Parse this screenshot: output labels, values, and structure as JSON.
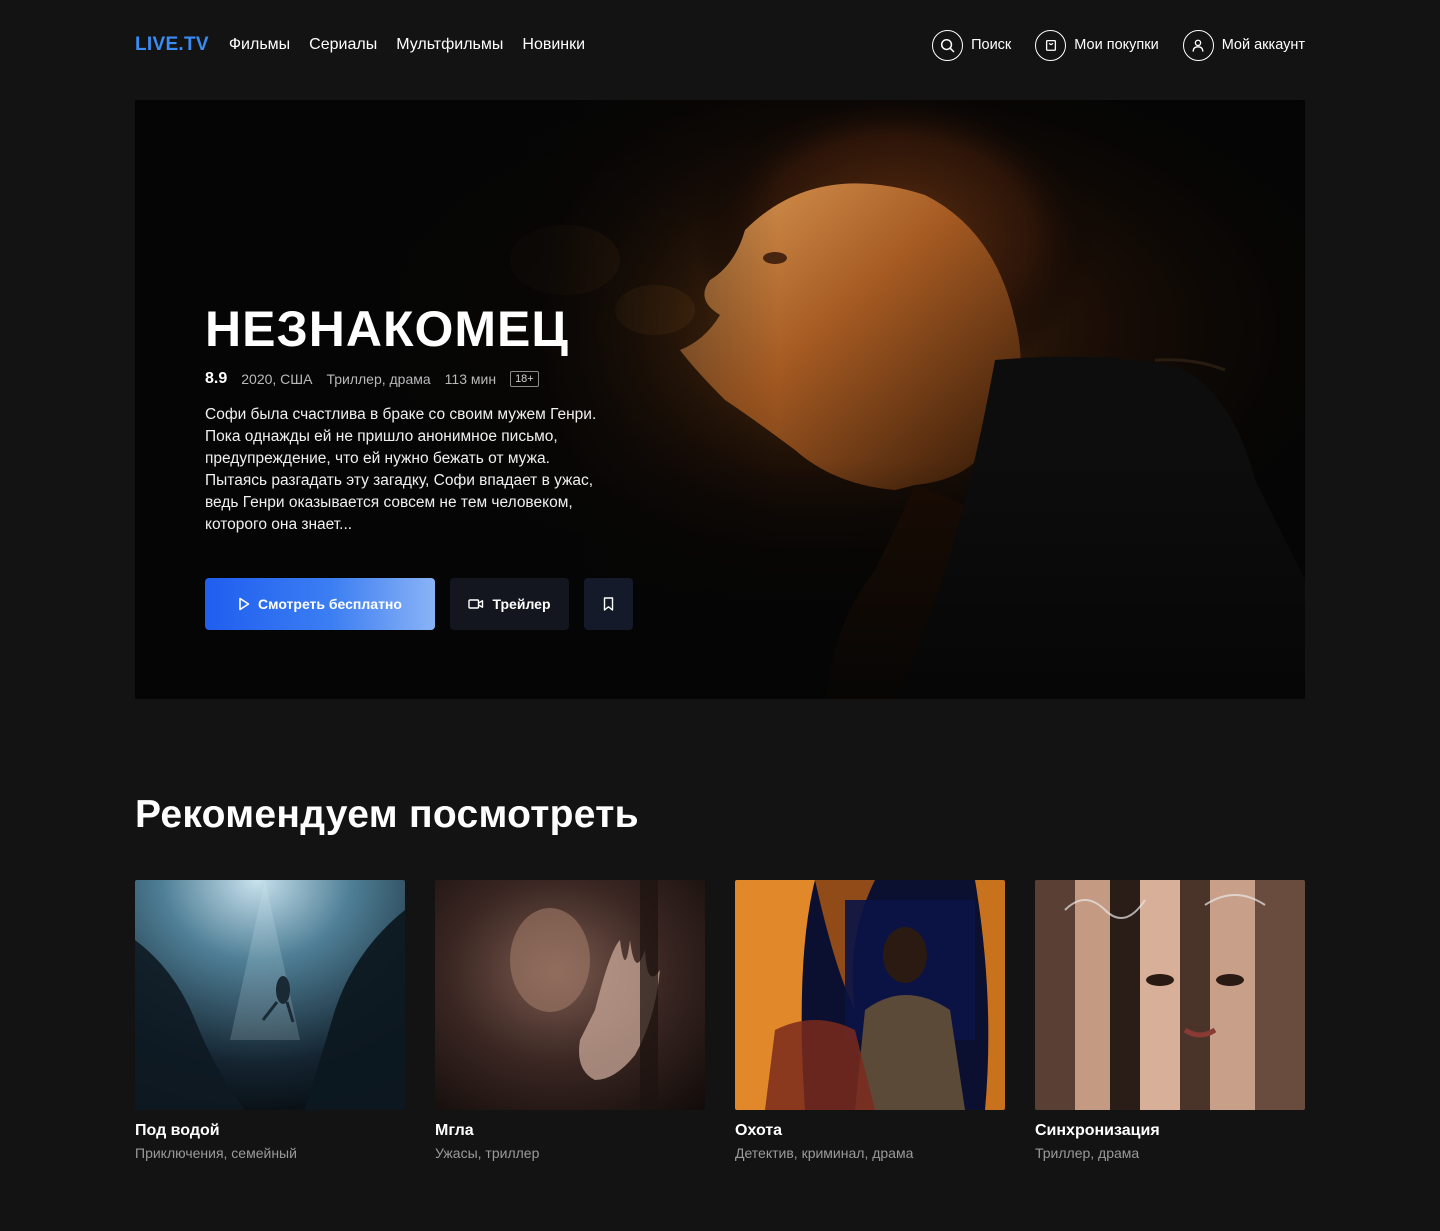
{
  "header": {
    "logo": "LIVE.TV",
    "nav": [
      "Фильмы",
      "Сериалы",
      "Мультфильмы",
      "Новинки"
    ],
    "actions": [
      {
        "label": "Поиск",
        "icon": "search-icon"
      },
      {
        "label": "Мои покупки",
        "icon": "bag-icon"
      },
      {
        "label": "Мой аккаунт",
        "icon": "user-icon"
      }
    ]
  },
  "hero": {
    "title": "НЕЗНАКОМЕЦ",
    "rating": "8.9",
    "year_country": "2020, США",
    "genres": "Триллер, драма",
    "duration": "113 мин",
    "age": "18+",
    "description": "Софи была счастлива в браке со своим мужем Генри. Пока однажды ей не пришло анонимное письмо, предупреждение, что ей нужно бежать от мужа. Пытаясь разгадать эту загадку, Софи впадает в ужас, ведь Генри оказывается совсем не тем человеком, которого она знает...",
    "watch_label": "Смотреть бесплатно",
    "trailer_label": "Трейлер",
    "colors": {
      "accent": "#1f5ef0",
      "accent_light": "#8ab3f6",
      "logo": "#3a8cf2"
    }
  },
  "recommended": {
    "title": "Рекомендуем посмотреть",
    "items": [
      {
        "title": "Под водой",
        "genres": "Приключения, семейный"
      },
      {
        "title": "Мгла",
        "genres": "Ужасы, триллер"
      },
      {
        "title": "Охота",
        "genres": "Детектив, криминал, драма"
      },
      {
        "title": "Синхронизация",
        "genres": "Триллер, драма"
      }
    ]
  }
}
